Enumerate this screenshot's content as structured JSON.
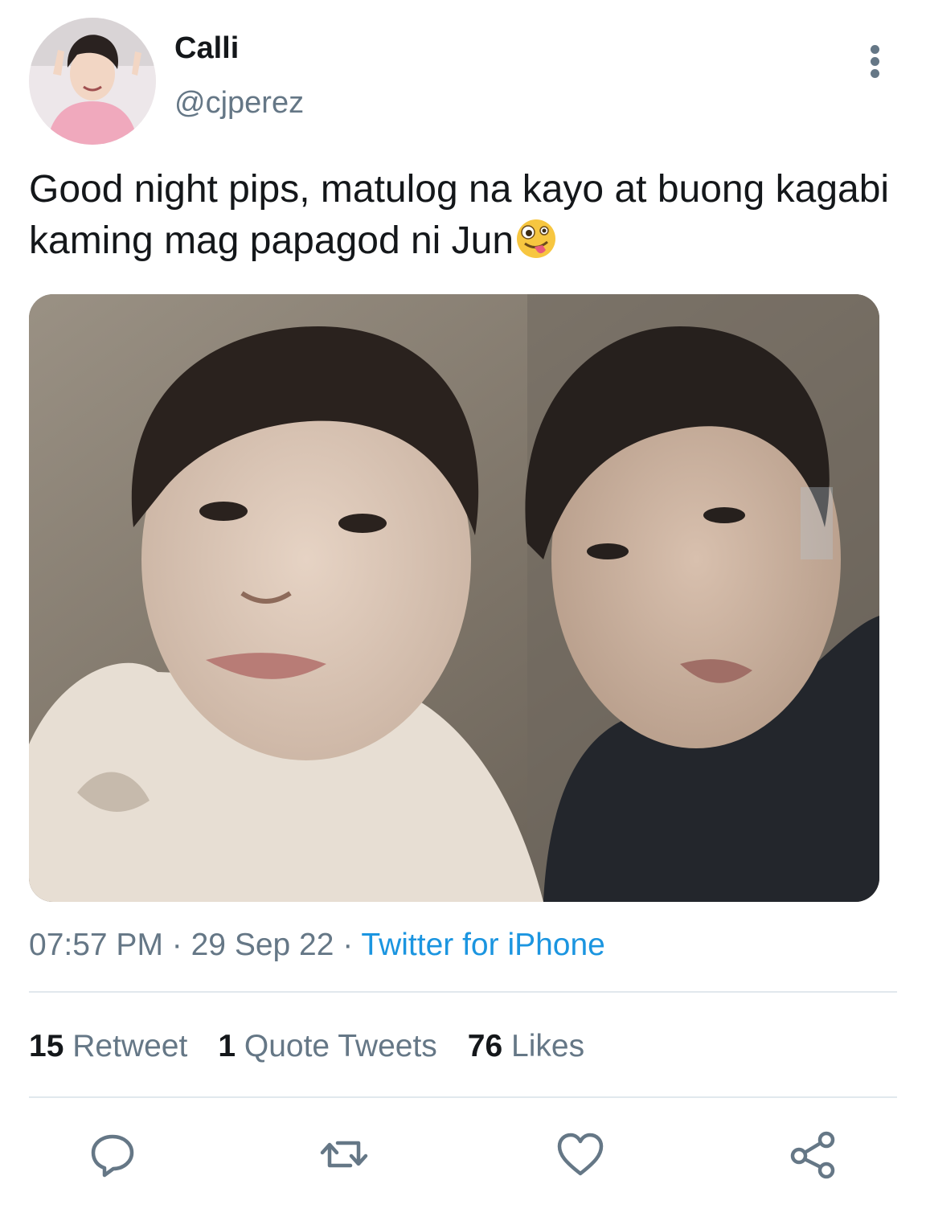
{
  "user": {
    "display_name": "Calli",
    "handle": "@cjperez",
    "avatar": "avatar-photo"
  },
  "tweet": {
    "text": "Good night pips, matulog na kayo at buong kagabi kaming mag papagod ni Jun",
    "emoji": "zany-face-emoji",
    "media": "photo-two-people-selfie",
    "time": "07:57 PM",
    "separator": " · ",
    "date": "29 Sep 22",
    "source": "Twitter for iPhone"
  },
  "stats": {
    "retweets_count": "15",
    "retweets_label": "Retweet",
    "quotes_count": "1",
    "quotes_label": "Quote Tweets",
    "likes_count": "76",
    "likes_label": "Likes"
  },
  "actions": [
    "reply-icon",
    "retweet-icon",
    "like-icon",
    "share-icon"
  ],
  "colors": {
    "text_primary": "#14171a",
    "text_secondary": "#657786",
    "link": "#1b95e0",
    "divider": "#e1e8ed"
  }
}
